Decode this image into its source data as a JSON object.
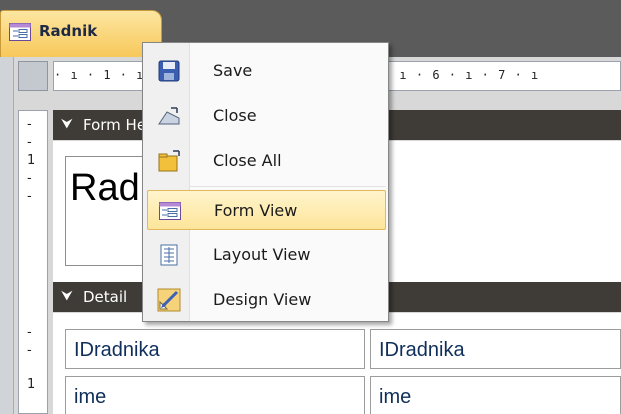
{
  "tab": {
    "label": "Radnik"
  },
  "ruler": {
    "ticks": "· ı · 1 · ı · 2 · ı · 3 · ı · 4 · ı · 5 · ı · 6 · ı · 7 · ı"
  },
  "vertical_ruler": {
    "mark_1": "1",
    "mark_2": "1"
  },
  "sections": {
    "form_header": {
      "label": "Form Header"
    },
    "detail": {
      "label": "Detail"
    }
  },
  "form_header": {
    "title": "Radnik"
  },
  "detail": {
    "rows": [
      {
        "label": "IDradnika",
        "field": "IDradnika"
      },
      {
        "label": "ime",
        "field": "ime"
      }
    ]
  },
  "context_menu": {
    "items": [
      {
        "label": "Save",
        "icon": "save-icon"
      },
      {
        "label": "Close",
        "icon": "close-icon"
      },
      {
        "label": "Close All",
        "icon": "close-all-icon"
      },
      {
        "label": "Form View",
        "icon": "form-view-icon",
        "selected": true
      },
      {
        "label": "Layout View",
        "icon": "layout-view-icon"
      },
      {
        "label": "Design View",
        "icon": "design-view-icon"
      }
    ]
  },
  "colors": {
    "tab_gradient_top": "#fde6a1",
    "tab_gradient_bottom": "#f7c85a",
    "section_bar": "#3f3b36",
    "menu_highlight": "#fde59a",
    "field_text": "#0f2f5a"
  }
}
